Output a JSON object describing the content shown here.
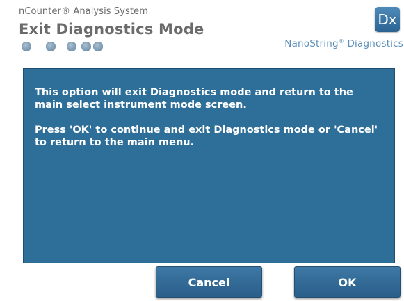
{
  "header": {
    "app_name": "nCounter® Analysis System",
    "screen_title": "Exit Diagnostics Mode",
    "mode_badge": "Dx",
    "brand": {
      "name": "NanoString",
      "mark": "®",
      "suffix": " Diagnostics"
    },
    "progress_steps": 5,
    "colors": {
      "title_gray": "#6b6b6b",
      "brand_blue": "#5b8fba"
    }
  },
  "message": {
    "paragraphs": [
      "This option will exit Diagnostics mode and return to the main select instrument mode screen.",
      "Press 'OK' to continue and exit Diagnostics mode or 'Cancel' to return to the main menu."
    ],
    "background_color": "#2e6f99"
  },
  "buttons": {
    "cancel_label": "Cancel",
    "ok_label": "OK",
    "color": "#346c98"
  }
}
